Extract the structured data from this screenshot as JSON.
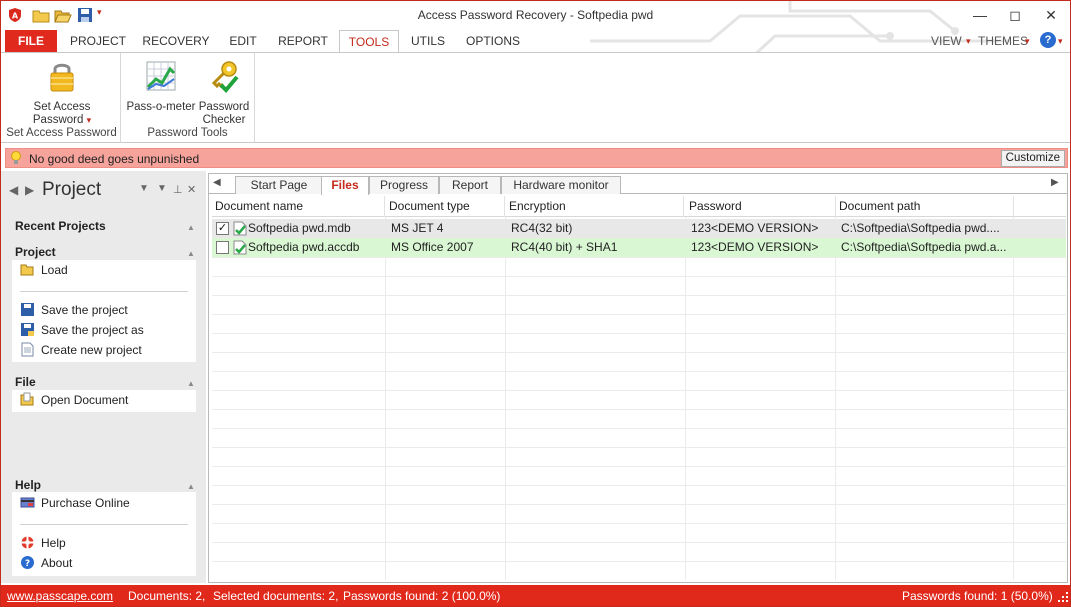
{
  "window": {
    "title": "Access Password Recovery - Softpedia pwd"
  },
  "ribbon_tabs": [
    "FILE",
    "PROJECT",
    "RECOVERY",
    "EDIT",
    "REPORT",
    "TOOLS",
    "UTILS",
    "OPTIONS"
  ],
  "ribbon_right": {
    "view": "VIEW",
    "themes": "THEMES",
    "help": "?"
  },
  "ribbon": {
    "set_access_password": {
      "line1": "Set Access",
      "line2": "Password",
      "group": "Set Access Password"
    },
    "pass_o_meter": {
      "label": "Pass-o-meter"
    },
    "password_checker": {
      "line1": "Password",
      "line2": "Checker"
    },
    "password_tools_group": "Password Tools"
  },
  "infobar": {
    "message": "No good deed goes unpunished",
    "customize": "Customize"
  },
  "left_panel": {
    "title": "Project",
    "recent_projects": "Recent Projects",
    "project_section": "Project",
    "project_items": [
      "Load",
      "Save the project",
      "Save the project as",
      "Create new project"
    ],
    "file_section": "File",
    "file_items": [
      "Open Document"
    ],
    "help_section": "Help",
    "help_items": [
      "Purchase Online",
      "Help",
      "About"
    ]
  },
  "doc_tabs": [
    "Start Page",
    "Files",
    "Progress",
    "Report",
    "Hardware monitor"
  ],
  "active_doc_tab": "Files",
  "table": {
    "columns": [
      "Document name",
      "Document type",
      "Encryption",
      "Password",
      "Document path"
    ],
    "rows": [
      {
        "checked": true,
        "name": "Softpedia pwd.mdb",
        "type": "MS JET 4",
        "encryption": "RC4(32 bit)",
        "password": "123<DEMO VERSION>",
        "path": "C:\\Softpedia\\Softpedia pwd...."
      },
      {
        "checked": false,
        "name": "Softpedia pwd.accdb",
        "type": "MS Office 2007",
        "encryption": "RC4(40 bit) + SHA1",
        "password": "123<DEMO VERSION>",
        "path": "C:\\Softpedia\\Softpedia pwd.a..."
      }
    ]
  },
  "statusbar": {
    "link": "www.passcape.com",
    "documents": "Documents: 2,",
    "selected": "Selected documents: 2,",
    "passwords_found": "Passwords found: 2 (100.0%)",
    "passwords_found_right": "Passwords found: 1 (50.0%)"
  },
  "colors": {
    "accent_red": "#e02a1e",
    "infobar_bg": "#f5a39b",
    "highlight_row": "#d9f7d3",
    "demo_blue": "#2255d6"
  }
}
